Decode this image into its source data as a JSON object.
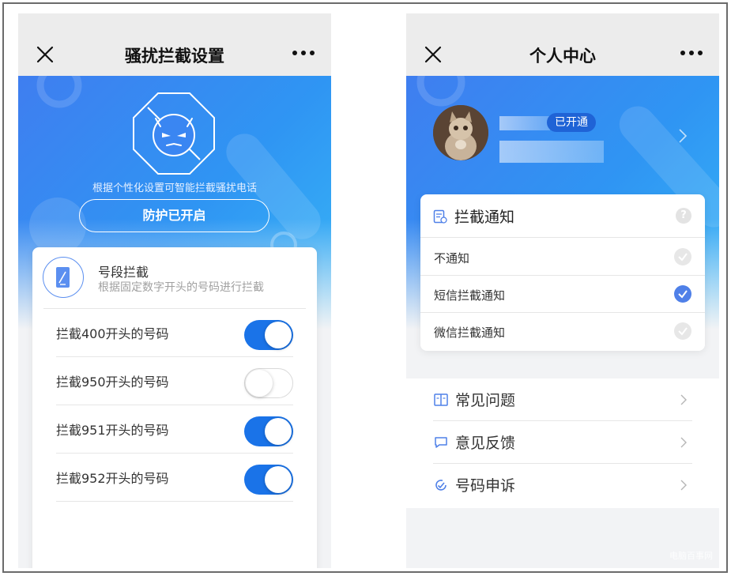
{
  "left": {
    "title": "骚扰拦截设置",
    "hero_caption": "根据个性化设置可智能拦截骚扰电话",
    "protect_button": "防护已开启",
    "segment": {
      "title": "号段拦截",
      "subtitle": "根据固定数字开头的号码进行拦截",
      "rows": [
        {
          "label": "拦截400开头的号码",
          "on": true
        },
        {
          "label": "拦截950开头的号码",
          "on": false
        },
        {
          "label": "拦截951开头的号码",
          "on": true
        },
        {
          "label": "拦截952开头的号码",
          "on": true
        }
      ]
    }
  },
  "right": {
    "title": "个人中心",
    "badge": "已开通",
    "notice": {
      "title": "拦截通知",
      "help": "?",
      "options": [
        {
          "label": "不通知",
          "selected": false
        },
        {
          "label": "短信拦截通知",
          "selected": true
        },
        {
          "label": "微信拦截通知",
          "selected": false
        }
      ]
    },
    "menu": [
      {
        "label": "常见问题",
        "icon": "book-icon"
      },
      {
        "label": "意见反馈",
        "icon": "chat-bubble-icon"
      },
      {
        "label": "号码申诉",
        "icon": "appeal-icon"
      }
    ],
    "watermark": "电脑百事网"
  },
  "colors": {
    "accent": "#1a73e8",
    "hero_start": "#3f7ef0",
    "hero_end": "#38b6f6",
    "check_on": "#4f80e8",
    "badge": "#1f63d6"
  }
}
